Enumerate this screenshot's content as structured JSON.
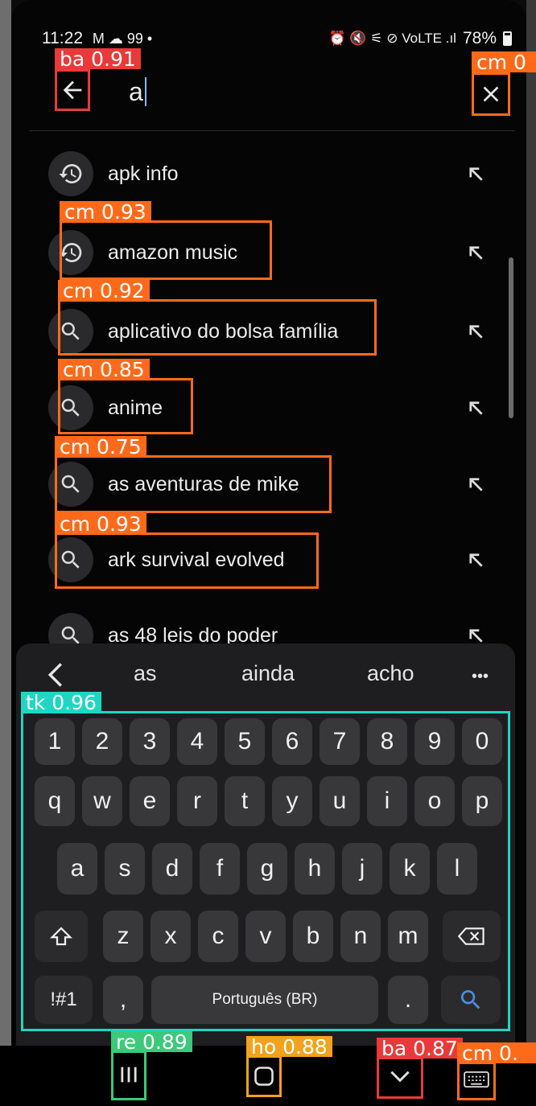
{
  "status_bar": {
    "time": "11:22",
    "left_icons": "M ☁ 99 •",
    "right_icons": "⏰ 🔇 ⚟ ⊘ VoLTE .ıl",
    "battery": "78%"
  },
  "search": {
    "query": "a"
  },
  "suggestions": [
    {
      "text": "apk info",
      "icon": "history-icon"
    },
    {
      "text": "amazon music",
      "icon": "history-icon"
    },
    {
      "text": "aplicativo do bolsa família",
      "icon": "search-icon"
    },
    {
      "text": "anime",
      "icon": "search-icon"
    },
    {
      "text": "as aventuras de mike",
      "icon": "search-icon"
    },
    {
      "text": "ark survival evolved",
      "icon": "search-icon"
    },
    {
      "text": "as 48 leis do poder",
      "icon": "search-icon"
    }
  ],
  "keyboard": {
    "predictions": [
      "as",
      "ainda",
      "acho"
    ],
    "more": "•••",
    "row_numbers": [
      "1",
      "2",
      "3",
      "4",
      "5",
      "6",
      "7",
      "8",
      "9",
      "0"
    ],
    "row_top": [
      "q",
      "w",
      "e",
      "r",
      "t",
      "y",
      "u",
      "i",
      "o",
      "p"
    ],
    "row_mid": [
      "a",
      "s",
      "d",
      "f",
      "g",
      "h",
      "j",
      "k",
      "l"
    ],
    "row_bottom": [
      "z",
      "x",
      "c",
      "v",
      "b",
      "n",
      "m"
    ],
    "symbols_key": "!#1",
    "comma_key": ",",
    "space_label": "Português (BR)",
    "period_key": "."
  },
  "detections": [
    {
      "label": "ba 0.91",
      "color": "#e83a3a"
    },
    {
      "label": "cm 0",
      "color": "#ff6a1a"
    },
    {
      "label": "cm 0.93",
      "color": "#ff6a1a"
    },
    {
      "label": "cm 0.92",
      "color": "#ff6a1a"
    },
    {
      "label": "cm 0.85",
      "color": "#ff6a1a"
    },
    {
      "label": "cm 0.75",
      "color": "#ff6a1a"
    },
    {
      "label": "cm 0.93",
      "color": "#ff6a1a"
    },
    {
      "label": "tk 0.96",
      "color": "#1fd6c3"
    },
    {
      "label": "re 0.89",
      "color": "#3bc97a"
    },
    {
      "label": "ho 0.88",
      "color": "#f2a21b"
    },
    {
      "label": "ba 0.87",
      "color": "#e83a3a"
    },
    {
      "label": "cm 0.",
      "color": "#ff6a1a"
    }
  ]
}
